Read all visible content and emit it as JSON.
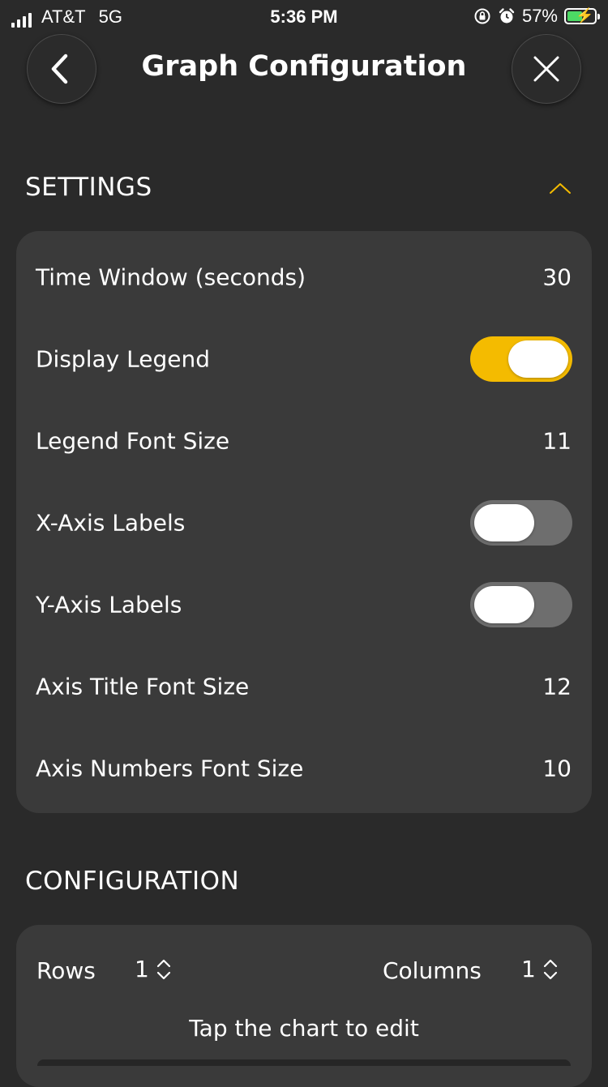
{
  "status_bar": {
    "carrier": "AT&T",
    "network": "5G",
    "time": "5:36 PM",
    "battery_percent": "57%",
    "battery_level": 0.57,
    "battery_color": "#4cd964"
  },
  "header": {
    "title": "Graph Configuration",
    "back_icon": "chevron-left-icon",
    "close_icon": "close-icon"
  },
  "settings": {
    "section_title": "SETTINGS",
    "collapse_icon": "chevron-up-icon",
    "accent_color": "#f4bb00",
    "rows": {
      "time_window": {
        "label": "Time Window (seconds)",
        "value": "30"
      },
      "display_legend": {
        "label": "Display Legend",
        "enabled": true
      },
      "legend_font_size": {
        "label": "Legend Font Size",
        "value": "11"
      },
      "x_axis_labels": {
        "label": "X-Axis Labels",
        "enabled": false
      },
      "y_axis_labels": {
        "label": "Y-Axis Labels",
        "enabled": false
      },
      "axis_title_font_size": {
        "label": "Axis Title Font Size",
        "value": "12"
      },
      "axis_numbers_font_size": {
        "label": "Axis Numbers Font Size",
        "value": "10"
      }
    }
  },
  "configuration": {
    "section_title": "CONFIGURATION",
    "rows_label": "Rows",
    "rows_value": "1",
    "columns_label": "Columns",
    "columns_value": "1",
    "hint": "Tap the chart to edit"
  }
}
